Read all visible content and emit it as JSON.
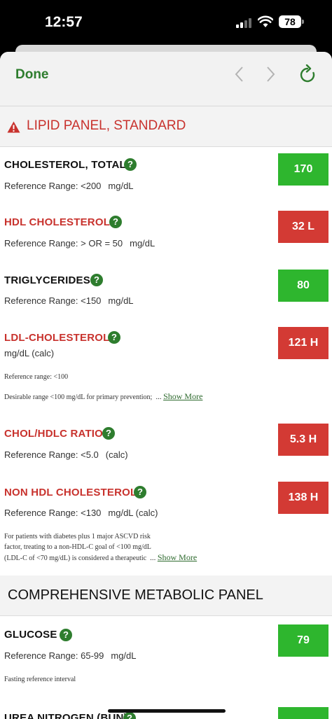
{
  "status_bar": {
    "time": "12:57",
    "battery": "78"
  },
  "nav": {
    "done_label": "Done"
  },
  "sections": [
    {
      "title": "LIPID PANEL, STANDARD",
      "tests": [
        {
          "name": "CHOLESTEROL, TOTAL",
          "ref": "Reference Range: <200",
          "unit": "mg/dL",
          "value": "170"
        },
        {
          "name": "HDL CHOLESTEROL",
          "ref": "Reference Range: > OR = 50",
          "unit": "mg/dL",
          "value": "32 L"
        },
        {
          "name": "TRIGLYCERIDES",
          "ref": "Reference Range: <150",
          "unit": "mg/dL",
          "value": "80"
        },
        {
          "name": "LDL-CHOLESTEROL",
          "ref": "mg/dL (calc)",
          "value": "121 H",
          "note1": "Reference range: <100",
          "note2": "Desirable range <100 mg/dL for primary prevention;",
          "ellipsis": "...",
          "show_more": "Show More"
        },
        {
          "name": "CHOL/HDLC RATIO",
          "ref": "Reference Range: <5.0",
          "unit": "(calc)",
          "value": "5.3 H"
        },
        {
          "name": "NON HDL CHOLESTEROL",
          "ref": "Reference Range: <130",
          "unit": "mg/dL (calc)",
          "value": "138 H",
          "note_lines": [
            "For patients with diabetes plus 1 major ASCVD risk",
            "factor, treating to a non-HDL-C goal of <100 mg/dL",
            "(LDL-C of <70 mg/dL) is considered a therapeutic"
          ],
          "ellipsis": "...",
          "show_more": "Show More"
        }
      ]
    },
    {
      "title": "COMPREHENSIVE METABOLIC PANEL",
      "tests": [
        {
          "name": "GLUCOSE",
          "ref": "Reference Range: 65-99",
          "unit": "mg/dL",
          "value": "79",
          "note1": "Fasting reference interval"
        },
        {
          "name": "UREA NITROGEN (BUN)"
        }
      ]
    }
  ],
  "colors": {
    "normal": "#2eb62e",
    "abnormal": "#d33a34",
    "accent_green": "#2e7d2e",
    "header_red": "#c8322d"
  },
  "icons": [
    "back-chevron-icon",
    "forward-chevron-icon",
    "refresh-icon",
    "warning-triangle-icon",
    "help-question-icon"
  ]
}
